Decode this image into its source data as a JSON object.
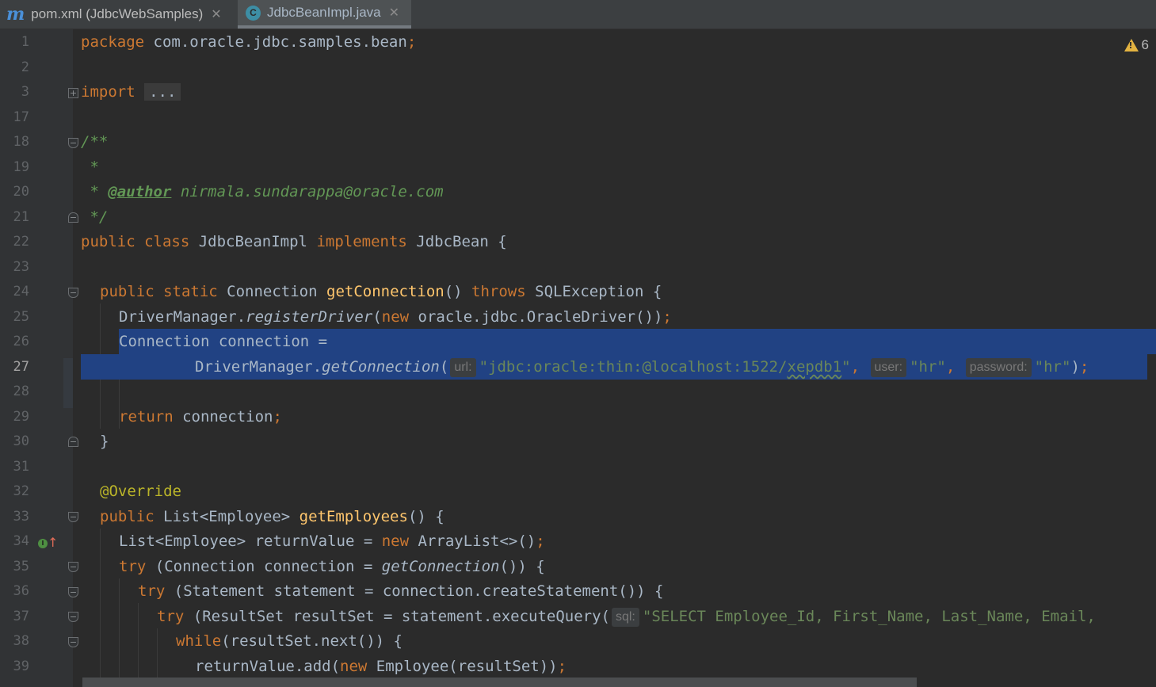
{
  "tabs": [
    {
      "label": "pom.xml (JdbcWebSamples)",
      "icon": "maven-icon",
      "active": false
    },
    {
      "label": "JdbcBeanImpl.java",
      "icon": "java-class-icon",
      "active": true
    }
  ],
  "inspections": {
    "warning_count": "6"
  },
  "line_numbers": [
    "1",
    "2",
    "3",
    "17",
    "18",
    "19",
    "20",
    "21",
    "22",
    "23",
    "24",
    "25",
    "26",
    "27",
    "28",
    "29",
    "30",
    "31",
    "32",
    "33",
    "34",
    "35",
    "36",
    "37",
    "38",
    "39"
  ],
  "code": {
    "l1": {
      "kw": "package",
      "rest": " com.oracle.jdbc.samples.bean",
      "semi": ";"
    },
    "l3": {
      "kw": "import",
      "folded": "..."
    },
    "l18": {
      "doc": "/**"
    },
    "l19": {
      "doc": " *"
    },
    "l20": {
      "doc_pre": " * ",
      "tag": "@author",
      "doc_post": " nirmala.sundarappa@oracle.com"
    },
    "l21": {
      "doc": " */"
    },
    "l22": {
      "kw1": "public class",
      "name": " JdbcBeanImpl ",
      "kw2": "implements",
      "rest": " JdbcBean {"
    },
    "l24": {
      "kw1": "public static",
      "type": " Connection ",
      "fn": "getConnection",
      "mid": "() ",
      "kw2": "throws",
      "rest": " SQLException {"
    },
    "l25": {
      "cls": "DriverManager.",
      "method": "registerDriver",
      "open": "(",
      "kw": "new",
      "rest": " oracle.jdbc.OracleDriver())",
      "semi": ";"
    },
    "l26": {
      "text": "Connection connection ="
    },
    "l27": {
      "cls": "DriverManager.",
      "method": "getConnection",
      "open": "(",
      "hint_url": "url:",
      "url": "\"jdbc:oracle:thin:@localhost:1522/",
      "db": "xepdb1",
      "url_end": "\"",
      "comma1": ",",
      "hint_user": "user:",
      "user": "\"hr\"",
      "comma2": ",",
      "hint_password": "password:",
      "password": "\"hr\"",
      "close": ")",
      "semi": ";"
    },
    "l29": {
      "kw": "return",
      "rest": " connection",
      "semi": ";"
    },
    "l30": {
      "text": "}"
    },
    "l32": {
      "ann": "@Override"
    },
    "l33": {
      "kw": "public",
      "type": " List<Employee> ",
      "fn": "getEmployees",
      "rest": "() {"
    },
    "l34": {
      "type": "List<Employee> returnValue = ",
      "kw": "new",
      "rest": " ArrayList<>()",
      "semi": ";"
    },
    "l35": {
      "kw": "try",
      "mid": " (Connection connection = ",
      "method": "getConnection",
      "rest": "()) {"
    },
    "l36": {
      "kw": "try",
      "rest": " (Statement statement = connection.createStatement()) {"
    },
    "l37": {
      "kw": "try",
      "rest": " (ResultSet resultSet = statement.executeQuery(",
      "hint_sql": "sql:",
      "sql": "\"SELECT Employee_Id, First_Name, Last_Name, Email,"
    },
    "l38": {
      "kw": "while",
      "rest": "(resultSet.next()) {"
    },
    "l39": {
      "pre": "returnValue.add(",
      "kw": "new",
      "rest": " Employee(resultSet))",
      "semi": ";"
    }
  }
}
